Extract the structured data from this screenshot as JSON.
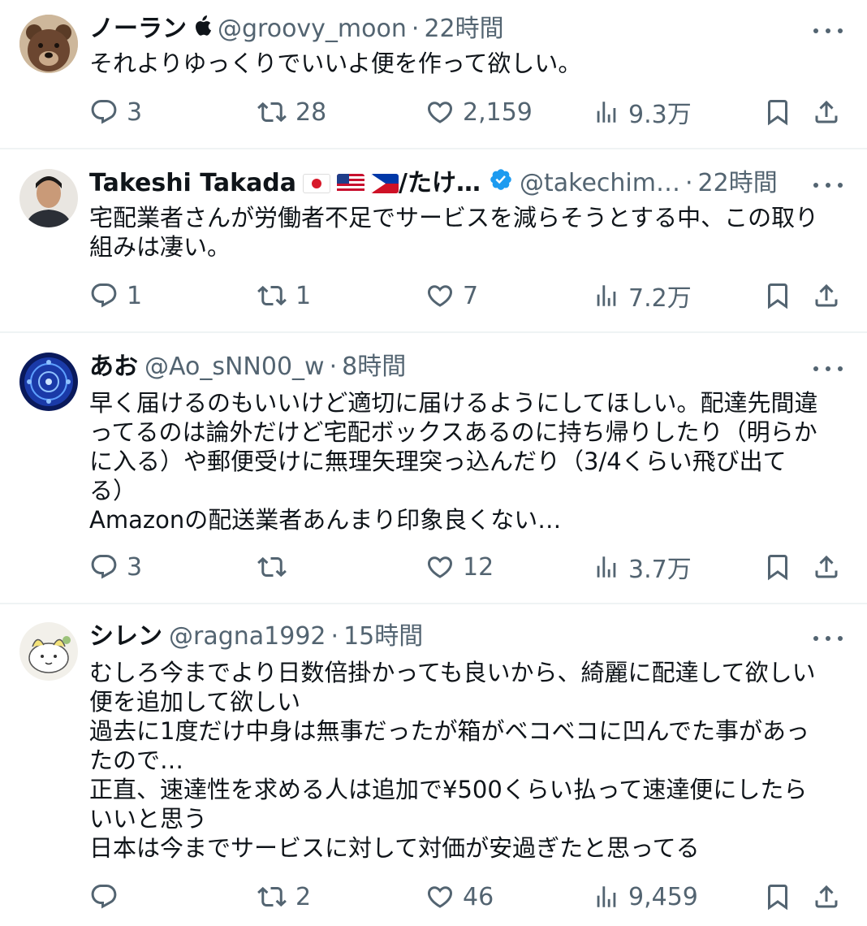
{
  "posts": [
    {
      "name": "ノーラン",
      "handle": "@groovy_moon",
      "separator": "·",
      "time": "22時間",
      "body": "それよりゆっくりでいいよ便を作って欲しい。",
      "replies": "3",
      "reposts": "28",
      "likes": "2,159",
      "views": "9.3万",
      "avatar": "bear-avatar",
      "badge": "apple-icon"
    },
    {
      "name": "Takeshi Takada",
      "name_suffix": "/たけ…",
      "handle": "@takechim…",
      "separator": "·",
      "time": "22時間",
      "body": "宅配業者さんが労働者不足でサービスを減らそうとする中、この取り\n組みは凄い。",
      "replies": "1",
      "reposts": "1",
      "likes": "7",
      "views": "7.2万",
      "avatar": "person-photo-avatar",
      "badge": "verified-icon"
    },
    {
      "name": "あお",
      "handle": "@Ao_sNN00_w",
      "separator": "·",
      "time": "8時間",
      "body": "早く届けるのもいいけど適切に届けるようにしてほしい。配達先間違\nってるのは論外だけど宅配ボックスあるのに持ち帰りしたり（明らか\nに入る）や郵便受けに無理矢理突っ込んだり（3/4くらい飛び出て\nる）\nAmazonの配送業者あんまり印象良くない…",
      "replies": "3",
      "reposts": "",
      "likes": "12",
      "views": "3.7万",
      "avatar": "blue-circle-avatar"
    },
    {
      "name": "シレン",
      "handle": "@ragna1992",
      "separator": "·",
      "time": "15時間",
      "body": "むしろ今までより日数倍掛かっても良いから、綺麗に配達して欲しい\n便を追加して欲しい\n過去に1度だけ中身は無事だったが箱がベコベコに凹んでた事があっ\nたので…\n正直、速達性を求める人は追加で¥500くらい払って速達便にしたら\nいいと思う\n日本は今までサービスに対して対価が安過ぎたと思ってる",
      "replies": "",
      "reposts": "2",
      "likes": "46",
      "views": "9,459",
      "avatar": "cat-drawing-avatar"
    }
  ],
  "icons": {
    "reply": "reply-icon",
    "repost": "repost-icon",
    "like": "heart-icon",
    "views": "views-icon",
    "bookmark": "bookmark-icon",
    "share": "share-icon",
    "more": "more-icon"
  },
  "colors": {
    "text": "#0f1419",
    "secondary": "#536471",
    "divider": "#eff3f4",
    "verified": "#1d9bf0"
  }
}
